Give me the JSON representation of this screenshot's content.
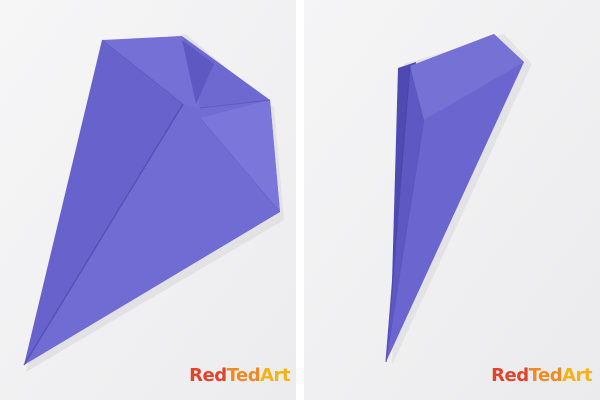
{
  "image": {
    "panels": [
      {
        "id": "left",
        "subject": "folded purple paper kite shape with top flaps folded down",
        "watermark": {
          "parts": [
            "Red",
            "Ted",
            "Art"
          ]
        }
      },
      {
        "id": "right",
        "subject": "purple paper folded into a narrow long cone shape",
        "watermark": {
          "parts": [
            "Red",
            "Ted",
            "Art"
          ]
        }
      }
    ],
    "colors": {
      "background": "#f3f3f4",
      "paper_main": "#6a65cf",
      "paper_light": "#7c78d8",
      "paper_shadow": "#5650b8",
      "watermark_red": "#e0442b",
      "watermark_orange": "#f08a24",
      "watermark_yellow": "#f5b316"
    }
  }
}
